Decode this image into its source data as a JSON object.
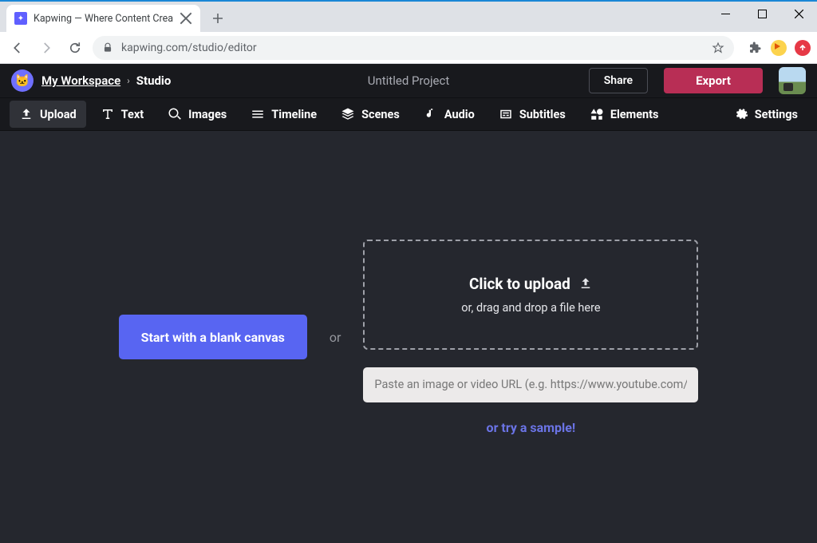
{
  "browser": {
    "tab_title": "Kapwing — Where Content Crea",
    "url": "kapwing.com/studio/editor"
  },
  "header": {
    "workspace_label": "My Workspace",
    "breadcrumb_sep": "›",
    "studio_label": "Studio",
    "project_title": "Untitled Project",
    "share_label": "Share",
    "export_label": "Export"
  },
  "tools": {
    "upload": "Upload",
    "text": "Text",
    "images": "Images",
    "timeline": "Timeline",
    "scenes": "Scenes",
    "audio": "Audio",
    "subtitles": "Subtitles",
    "elements": "Elements",
    "settings": "Settings"
  },
  "main": {
    "blank_canvas_label": "Start with a blank canvas",
    "or_label": "or",
    "dropzone_title": "Click to upload",
    "dropzone_sub": "or, drag and drop a file here",
    "url_placeholder": "Paste an image or video URL (e.g. https://www.youtube.com/watch?v=...)",
    "sample_label": "or try a sample!"
  }
}
